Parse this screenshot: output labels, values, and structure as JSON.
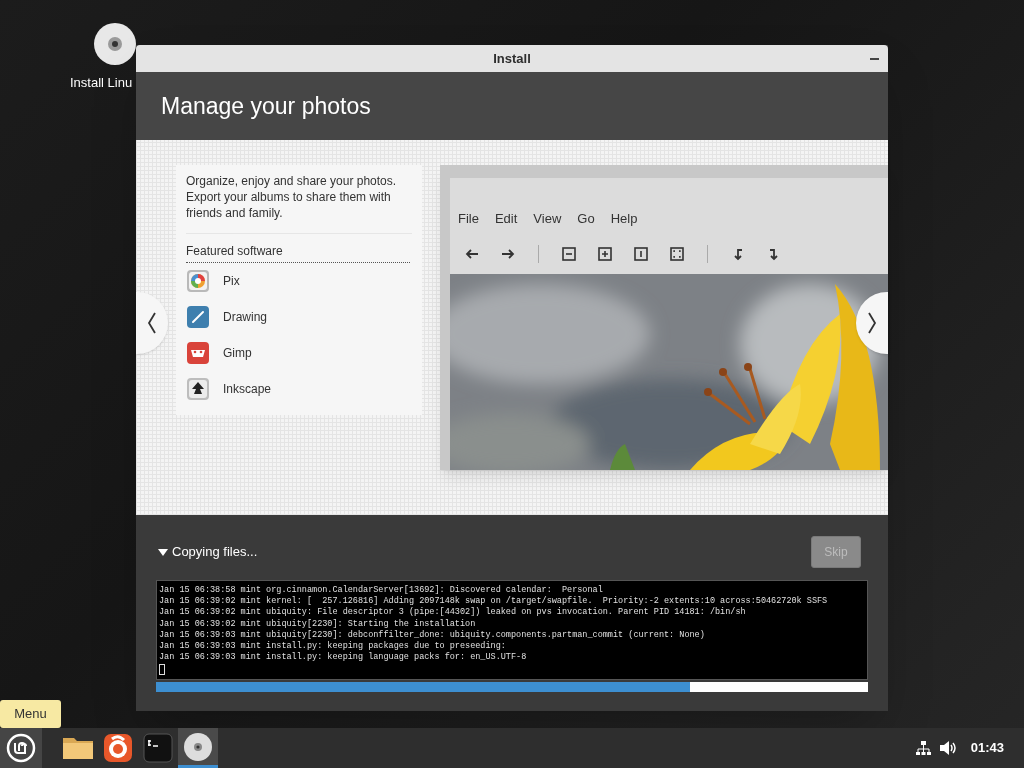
{
  "desktop_icons": [
    {
      "label": "Install Linu"
    }
  ],
  "tooltip": "Menu",
  "window": {
    "title": "Install",
    "header": "Manage your photos",
    "slide": {
      "description": "Organize, enjoy and share your photos. Export your albums to share them with friends and family.",
      "featured_heading": "Featured software",
      "apps": [
        {
          "kind": "pix",
          "name": "Pix"
        },
        {
          "kind": "drawing",
          "name": "Drawing"
        },
        {
          "kind": "gimp",
          "name": "Gimp"
        },
        {
          "kind": "inkscape",
          "name": "Inkscape"
        }
      ],
      "preview": {
        "menu": [
          "File",
          "Edit",
          "View",
          "Go",
          "Help"
        ]
      }
    },
    "progress": {
      "label": "Copying files...",
      "expanded": true,
      "skip": {
        "label": "Skip",
        "disabled": true
      },
      "log": [
        "Jan 15 06:38:58 mint org.cinnamon.CalendarServer[13692]: Discovered calendar:  Personal",
        "Jan 15 06:39:02 mint kernel: [  257.126816] Adding 2097148k swap on /target/swapfile.  Priority:-2 extents:10 across:50462720k SSFS",
        "Jan 15 06:39:02 mint ubiquity: File descriptor 3 (pipe:[44302]) leaked on pvs invocation. Parent PID 14181: /bin/sh",
        "Jan 15 06:39:02 mint ubiquity[2230]: Starting the installation",
        "Jan 15 06:39:03 mint ubiquity[2230]: debconffilter_done: ubiquity.components.partman_commit (current: None)",
        "Jan 15 06:39:03 mint install.py: keeping packages due to preseeding:",
        "Jan 15 06:39:03 mint install.py: keeping language packs for: en_US.UTF-8"
      ],
      "level": 0.75
    }
  },
  "taskbar": {
    "launchers": [
      {
        "kind": "files",
        "active": false
      },
      {
        "kind": "browser",
        "active": false
      },
      {
        "kind": "terminal",
        "active": false
      },
      {
        "kind": "disc",
        "active": true
      }
    ],
    "clock": "01:43"
  }
}
